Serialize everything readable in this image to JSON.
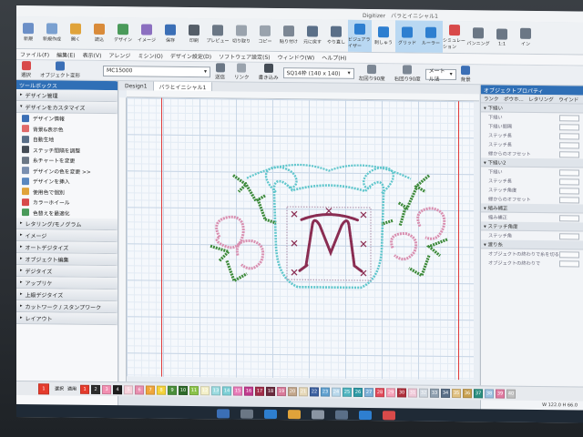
{
  "window": {
    "app_title": "Digitizer　バラとイニシャル1"
  },
  "ribbon": [
    {
      "label": "新規",
      "color": "#6b8fc7"
    },
    {
      "label": "新規作成",
      "color": "#7aa0d0"
    },
    {
      "label": "開く",
      "color": "#e0a33a"
    },
    {
      "label": "読込",
      "color": "#d98b3a"
    },
    {
      "label": "デザイン",
      "color": "#4a9a5a"
    },
    {
      "label": "イメージ",
      "color": "#8b6fc0"
    },
    {
      "label": "保存",
      "color": "#3b6fb6"
    },
    {
      "label": "印刷",
      "color": "#555e68"
    },
    {
      "label": "プレビュー",
      "color": "#6b7785"
    },
    {
      "label": "切り取り",
      "color": "#9aa3ad"
    },
    {
      "label": "コピー",
      "color": "#9aa3ad"
    },
    {
      "label": "貼り付け",
      "color": "#7c8794"
    },
    {
      "label": "元に戻す",
      "color": "#5a6f88"
    },
    {
      "label": "やり直し",
      "color": "#5a6f88"
    },
    {
      "label": "ビジュアライザー",
      "color": "#2e7fd0",
      "active": true
    },
    {
      "label": "刺しゅう",
      "color": "#2e7fd0"
    },
    {
      "label": "グリッド",
      "color": "#2e7fd0",
      "active": true
    },
    {
      "label": "ルーラー",
      "color": "#2e7fd0",
      "active": true
    },
    {
      "label": "シミュレーション",
      "color": "#d84a4a"
    },
    {
      "label": "パンニング",
      "color": "#6b7785"
    },
    {
      "label": "1:1",
      "color": "#6b7785"
    },
    {
      "label": "イン",
      "color": "#6b7785"
    }
  ],
  "menu": [
    "ファイル(F)",
    "編集(E)",
    "表示(V)",
    "アレンジ",
    "ミシン(O)",
    "デザイン設定(D)",
    "ソフトウェア設定(S)",
    "ウィンドウ(W)",
    "ヘルプ(H)"
  ],
  "toolbar2": {
    "select_label": "選択",
    "object_transform_label": "オブジェクト変形",
    "thread_combo": "MC15000",
    "send_label": "送信",
    "link_label": "リンク",
    "write_label": "書き込み",
    "hoop_combo": "SQ14枠 (140 x 140)",
    "rotate_left_label": "左回り90度",
    "rotate_right_label": "右回り90度",
    "unit_combo": "メートル法",
    "background_label": "背景"
  },
  "toolbox": {
    "title": "ツールボックス",
    "sections_top": [
      {
        "label": "デザイン管理",
        "collapsed": true
      },
      {
        "label": "デザインをカスタマイズ",
        "collapsed": false
      }
    ],
    "items": [
      {
        "label": "デザイン情報",
        "color": "#3b6fb6",
        "icon": "info-icon"
      },
      {
        "label": "背景&表示色",
        "color": "#e06a6a",
        "icon": "background-color-icon"
      },
      {
        "label": "自動生地",
        "color": "#5a6f88",
        "icon": "fabric-icon"
      },
      {
        "label": "ステッチ間隔を調整",
        "color": "#444c55",
        "icon": "stitch-spacing-icon"
      },
      {
        "label": "糸チャートを変更",
        "color": "#6b7785",
        "icon": "thread-chart-icon"
      },
      {
        "label": "デザインの色を変更 >>",
        "color": "#7a8fb0",
        "icon": "recolor-icon"
      },
      {
        "label": "デザインを挿入",
        "color": "#5a88c0",
        "icon": "insert-design-icon"
      },
      {
        "label": "使用色で個別",
        "color": "#e0a33a",
        "icon": "color-wheel-icon"
      },
      {
        "label": "カラーホイール",
        "color": "#d84a4a",
        "icon": "palette-icon"
      },
      {
        "label": "色替えを最適化",
        "color": "#4a9a5a",
        "icon": "optimize-color-icon"
      }
    ],
    "sections_bottom": [
      "レタリング/モノグラム",
      "イメージ",
      "オートデジタイズ",
      "オブジェクト編集",
      "デジタイズ",
      "アップリケ",
      "上級デジタイズ",
      "カットワーク / スタンプワーク",
      "レイアウト"
    ]
  },
  "tabs": [
    {
      "label": "Design1",
      "selected": false
    },
    {
      "label": "バラとイニシャル1",
      "selected": true
    }
  ],
  "properties": {
    "title": "オブジェクトプロパティ",
    "tabs_row": "ランク　ポウホ...　レタリング　ウインド",
    "groups": [
      {
        "label": "下縫い",
        "rows": [
          "下縫い",
          "下縫い間隔",
          "ステッチ長",
          "ステッチ長",
          "縁からのオフセット"
        ]
      },
      {
        "label": "下縫い2",
        "rows": [
          "下縫い",
          "ステッチ長",
          "ステッチ角度",
          "縁からのオフセット"
        ]
      },
      {
        "label": "縮み補正",
        "rows": [
          "縮み補正"
        ]
      },
      {
        "label": "ステッチ角度",
        "rows": [
          "ステッチ角"
        ]
      },
      {
        "label": "渡り糸",
        "rows": [
          "オブジェクトの終わりで糸を切る",
          "オブジェクトの終わりで"
        ]
      }
    ]
  },
  "palette": [
    {
      "n": "1",
      "c": "#e53b2c"
    },
    {
      "n": "2",
      "c": "#2d2d2d"
    },
    {
      "n": "3",
      "c": "#f28fb1"
    },
    {
      "n": "4",
      "c": "#1e1e1e"
    },
    {
      "n": "5",
      "c": "#f7d2dc"
    },
    {
      "n": "6",
      "c": "#e98fb0"
    },
    {
      "n": "7",
      "c": "#f0a63b"
    },
    {
      "n": "8",
      "c": "#f5d33c"
    },
    {
      "n": "9",
      "c": "#4a8f3a"
    },
    {
      "n": "10",
      "c": "#2f6b2a"
    },
    {
      "n": "11",
      "c": "#8bc34a"
    },
    {
      "n": "12",
      "c": "#f4f0c8"
    },
    {
      "n": "13",
      "c": "#9adbe0"
    },
    {
      "n": "14",
      "c": "#7ccfd6"
    },
    {
      "n": "15",
      "c": "#e87ab8"
    },
    {
      "n": "16",
      "c": "#c23b8f"
    },
    {
      "n": "17",
      "c": "#a22e4a"
    },
    {
      "n": "18",
      "c": "#6b2b3e"
    },
    {
      "n": "19",
      "c": "#d97a9a"
    },
    {
      "n": "20",
      "c": "#c2a68b"
    },
    {
      "n": "21",
      "c": "#e6d8b8"
    },
    {
      "n": "22",
      "c": "#3a5fa0"
    },
    {
      "n": "23",
      "c": "#5fa0d0"
    },
    {
      "n": "24",
      "c": "#b8d8ec"
    },
    {
      "n": "25",
      "c": "#4fb5c0"
    },
    {
      "n": "26",
      "c": "#2e9aa6"
    },
    {
      "n": "27",
      "c": "#7fb0d8"
    },
    {
      "n": "28",
      "c": "#e24a5a"
    },
    {
      "n": "29",
      "c": "#f7a0b8"
    },
    {
      "n": "30",
      "c": "#b0303c"
    },
    {
      "n": "31",
      "c": "#f0c8d8"
    },
    {
      "n": "32",
      "c": "#d0d8e0"
    },
    {
      "n": "33",
      "c": "#8fa0b0"
    },
    {
      "n": "34",
      "c": "#5a6f88"
    },
    {
      "n": "35",
      "c": "#e0c080"
    },
    {
      "n": "36",
      "c": "#c8a050"
    },
    {
      "n": "37",
      "c": "#2a8f80"
    },
    {
      "n": "38",
      "c": "#9ac0e0"
    },
    {
      "n": "39",
      "c": "#e07aa0"
    },
    {
      "n": "40",
      "c": "#c0c0c0"
    }
  ],
  "bottom_tools": {
    "select_label": "選択",
    "apply_label": "適用",
    "selected_color_num": "1"
  },
  "status": "W 122.0 H 66.0",
  "embroidery_colors": {
    "teal": "#5fc6cc",
    "pink": "#d98fb0",
    "green": "#3d8a3a",
    "wine": "#8a2d52"
  }
}
